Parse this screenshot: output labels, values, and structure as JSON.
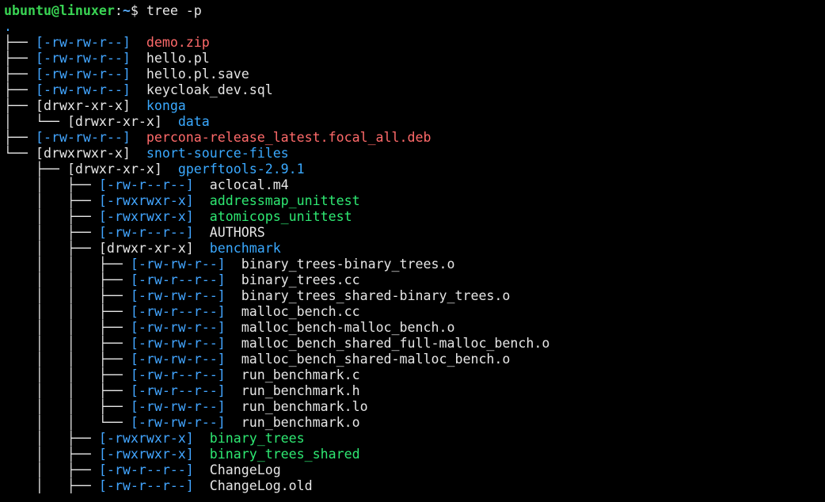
{
  "prompt": {
    "user_host": "ubuntu@linuxer",
    "colon": ":",
    "path": "~",
    "dollar": "$ ",
    "command": "tree -p"
  },
  "root": ".",
  "colors": {
    "background": "#000000",
    "prompt_user": "#39d353",
    "directory": "#3aa9ff",
    "executable": "#2ee872",
    "archive": "#ff6a6a",
    "permission_bracket": "#42a5ff"
  },
  "entries": [
    {
      "prefix": "├── ",
      "perm": "[-rw-rw-r--]",
      "sep": "  ",
      "name": "demo.zip",
      "kind": "archive"
    },
    {
      "prefix": "├── ",
      "perm": "[-rw-rw-r--]",
      "sep": "  ",
      "name": "hello.pl",
      "kind": "file"
    },
    {
      "prefix": "├── ",
      "perm": "[-rw-rw-r--]",
      "sep": "  ",
      "name": "hello.pl.save",
      "kind": "file"
    },
    {
      "prefix": "├── ",
      "perm": "[-rw-rw-r--]",
      "sep": "  ",
      "name": "keycloak_dev.sql",
      "kind": "file"
    },
    {
      "prefix": "├── ",
      "perm": "[drwxr-xr-x]",
      "sep": "  ",
      "name": "konga",
      "kind": "dir"
    },
    {
      "prefix": "│   └── ",
      "perm": "[drwxr-xr-x]",
      "sep": "  ",
      "name": "data",
      "kind": "dir"
    },
    {
      "prefix": "├── ",
      "perm": "[-rw-rw-r--]",
      "sep": "  ",
      "name": "percona-release_latest.focal_all.deb",
      "kind": "archive"
    },
    {
      "prefix": "└── ",
      "perm": "[drwxrwxr-x]",
      "sep": "  ",
      "name": "snort-source-files",
      "kind": "dir"
    },
    {
      "prefix": "    ├── ",
      "perm": "[drwxr-xr-x]",
      "sep": "  ",
      "name": "gperftools-2.9.1",
      "kind": "dir"
    },
    {
      "prefix": "    │   ├── ",
      "perm": "[-rw-r--r--]",
      "sep": "  ",
      "name": "aclocal.m4",
      "kind": "file"
    },
    {
      "prefix": "    │   ├── ",
      "perm": "[-rwxrwxr-x]",
      "sep": "  ",
      "name": "addressmap_unittest",
      "kind": "exec"
    },
    {
      "prefix": "    │   ├── ",
      "perm": "[-rwxrwxr-x]",
      "sep": "  ",
      "name": "atomicops_unittest",
      "kind": "exec"
    },
    {
      "prefix": "    │   ├── ",
      "perm": "[-rw-r--r--]",
      "sep": "  ",
      "name": "AUTHORS",
      "kind": "file"
    },
    {
      "prefix": "    │   ├── ",
      "perm": "[drwxr-xr-x]",
      "sep": "  ",
      "name": "benchmark",
      "kind": "dir"
    },
    {
      "prefix": "    │   │   ├── ",
      "perm": "[-rw-rw-r--]",
      "sep": "  ",
      "name": "binary_trees-binary_trees.o",
      "kind": "file"
    },
    {
      "prefix": "    │   │   ├── ",
      "perm": "[-rw-r--r--]",
      "sep": "  ",
      "name": "binary_trees.cc",
      "kind": "file"
    },
    {
      "prefix": "    │   │   ├── ",
      "perm": "[-rw-rw-r--]",
      "sep": "  ",
      "name": "binary_trees_shared-binary_trees.o",
      "kind": "file"
    },
    {
      "prefix": "    │   │   ├── ",
      "perm": "[-rw-r--r--]",
      "sep": "  ",
      "name": "malloc_bench.cc",
      "kind": "file"
    },
    {
      "prefix": "    │   │   ├── ",
      "perm": "[-rw-rw-r--]",
      "sep": "  ",
      "name": "malloc_bench-malloc_bench.o",
      "kind": "file"
    },
    {
      "prefix": "    │   │   ├── ",
      "perm": "[-rw-rw-r--]",
      "sep": "  ",
      "name": "malloc_bench_shared_full-malloc_bench.o",
      "kind": "file"
    },
    {
      "prefix": "    │   │   ├── ",
      "perm": "[-rw-rw-r--]",
      "sep": "  ",
      "name": "malloc_bench_shared-malloc_bench.o",
      "kind": "file"
    },
    {
      "prefix": "    │   │   ├── ",
      "perm": "[-rw-r--r--]",
      "sep": "  ",
      "name": "run_benchmark.c",
      "kind": "file"
    },
    {
      "prefix": "    │   │   ├── ",
      "perm": "[-rw-r--r--]",
      "sep": "  ",
      "name": "run_benchmark.h",
      "kind": "file"
    },
    {
      "prefix": "    │   │   ├── ",
      "perm": "[-rw-rw-r--]",
      "sep": "  ",
      "name": "run_benchmark.lo",
      "kind": "file"
    },
    {
      "prefix": "    │   │   └── ",
      "perm": "[-rw-rw-r--]",
      "sep": "  ",
      "name": "run_benchmark.o",
      "kind": "file"
    },
    {
      "prefix": "    │   ├── ",
      "perm": "[-rwxrwxr-x]",
      "sep": "  ",
      "name": "binary_trees",
      "kind": "exec"
    },
    {
      "prefix": "    │   ├── ",
      "perm": "[-rwxrwxr-x]",
      "sep": "  ",
      "name": "binary_trees_shared",
      "kind": "exec"
    },
    {
      "prefix": "    │   ├── ",
      "perm": "[-rw-r--r--]",
      "sep": "  ",
      "name": "ChangeLog",
      "kind": "file"
    },
    {
      "prefix": "    │   ├── ",
      "perm": "[-rw-r--r--]",
      "sep": "  ",
      "name": "ChangeLog.old",
      "kind": "file"
    }
  ]
}
